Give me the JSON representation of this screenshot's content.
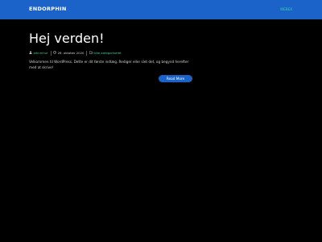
{
  "header": {
    "brand": "ENDORPHIN",
    "nav_link": "WEBEX"
  },
  "post": {
    "title": "Hej verden!",
    "meta": {
      "author": "johnrchur",
      "date": "26. oktober 2020",
      "category": "Ikke-kategoriseret"
    },
    "excerpt": "Velkommen til WordPress. Dette er dit første indlæg. Rediger eller slet det, og begynd herefter med at skrive!",
    "read_more": "Read More"
  },
  "colors": {
    "background": "#000000",
    "header": "#1c63c9",
    "accent_link": "#2dd4a8",
    "button": "#1c63c9"
  },
  "icons": [
    "user-icon",
    "clock-icon",
    "folder-icon"
  ]
}
